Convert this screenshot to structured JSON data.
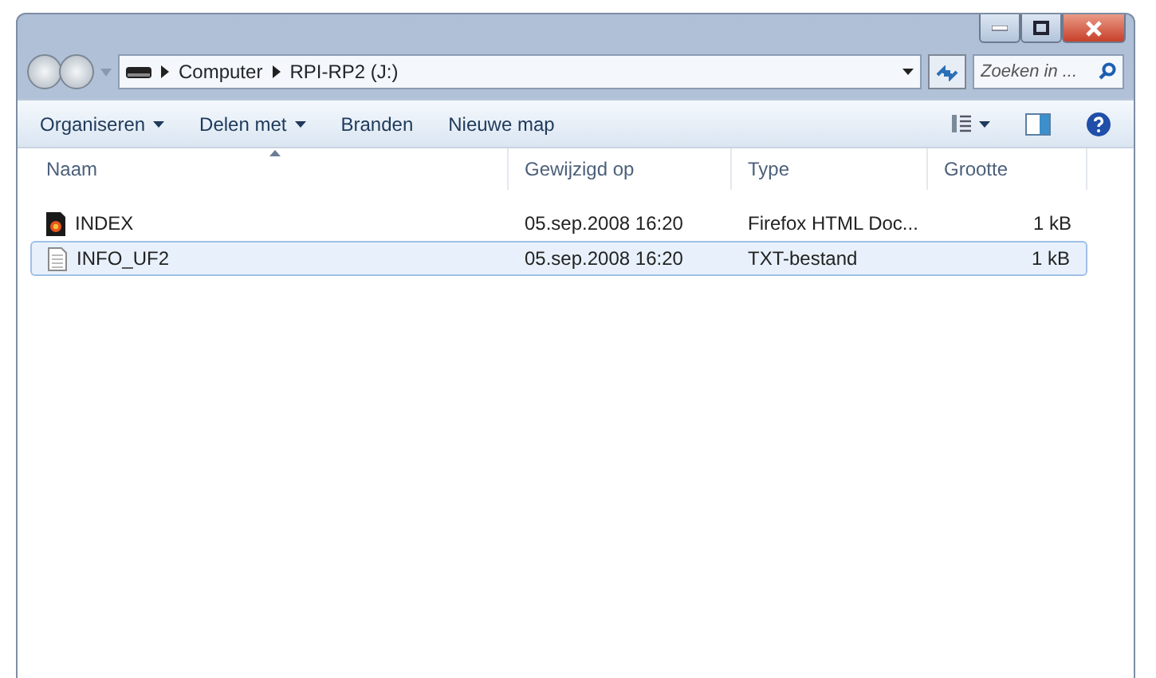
{
  "window": {
    "buttons": [
      {
        "kind": "minimize"
      },
      {
        "kind": "maximize"
      },
      {
        "kind": "close"
      }
    ]
  },
  "address_bar": {
    "crumbs": [
      "Computer",
      "RPI-RP2 (J:)"
    ]
  },
  "search": {
    "placeholder": "Zoeken in ..."
  },
  "toolbar": {
    "items": [
      {
        "label": "Organiseren",
        "dropdown": true
      },
      {
        "label": "Delen met",
        "dropdown": true
      },
      {
        "label": "Branden",
        "dropdown": false
      },
      {
        "label": "Nieuwe map",
        "dropdown": false
      }
    ]
  },
  "table": {
    "columns": [
      {
        "label": "Naam",
        "sorted": true
      },
      {
        "label": "Gewijzigd op",
        "sorted": false
      },
      {
        "label": "Type",
        "sorted": false
      },
      {
        "label": "Grootte",
        "sorted": false
      }
    ],
    "rows": [
      {
        "kind": "html",
        "name": "INDEX",
        "modified": "05.sep.2008 16:20",
        "type": "Firefox HTML Doc...",
        "size": "1 kB",
        "selected": false
      },
      {
        "kind": "text",
        "name": "INFO_UF2",
        "modified": "05.sep.2008 16:20",
        "type": "TXT-bestand",
        "size": "1 kB",
        "selected": true
      }
    ]
  }
}
